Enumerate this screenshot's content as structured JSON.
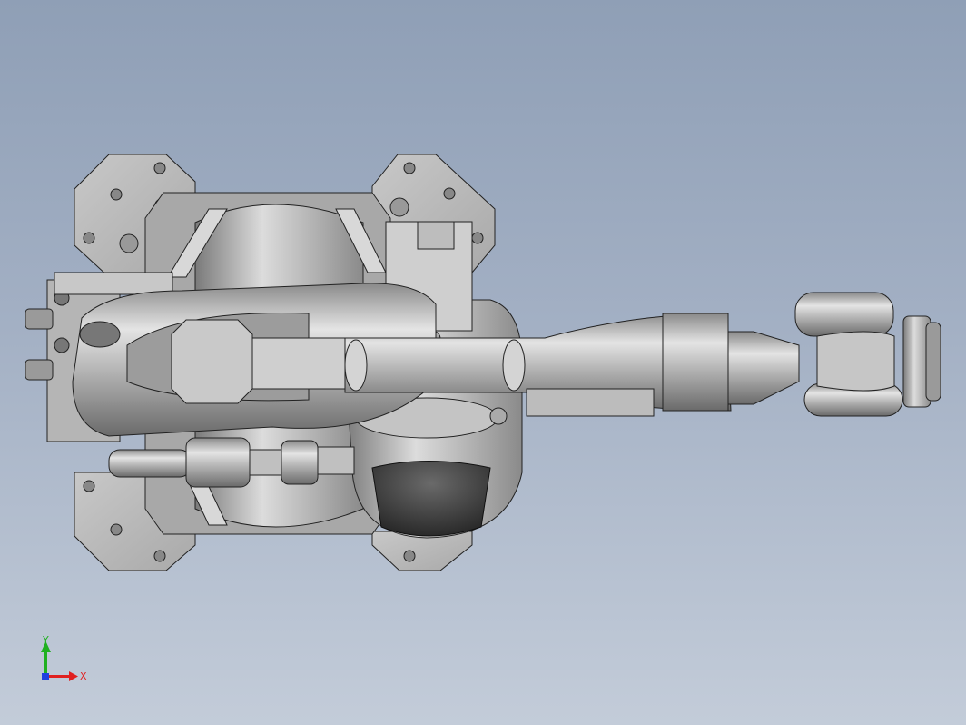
{
  "viewport": {
    "background_top": "#8f9fb6",
    "background_bottom": "#c3ccd9"
  },
  "model": {
    "part_color": "#b9b9b9",
    "edge_color": "#1a1a1a"
  },
  "triad": {
    "x_label": "X",
    "y_label": "Y",
    "x_color": "#e02020",
    "y_color": "#20b020",
    "z_color": "#2040e0"
  }
}
